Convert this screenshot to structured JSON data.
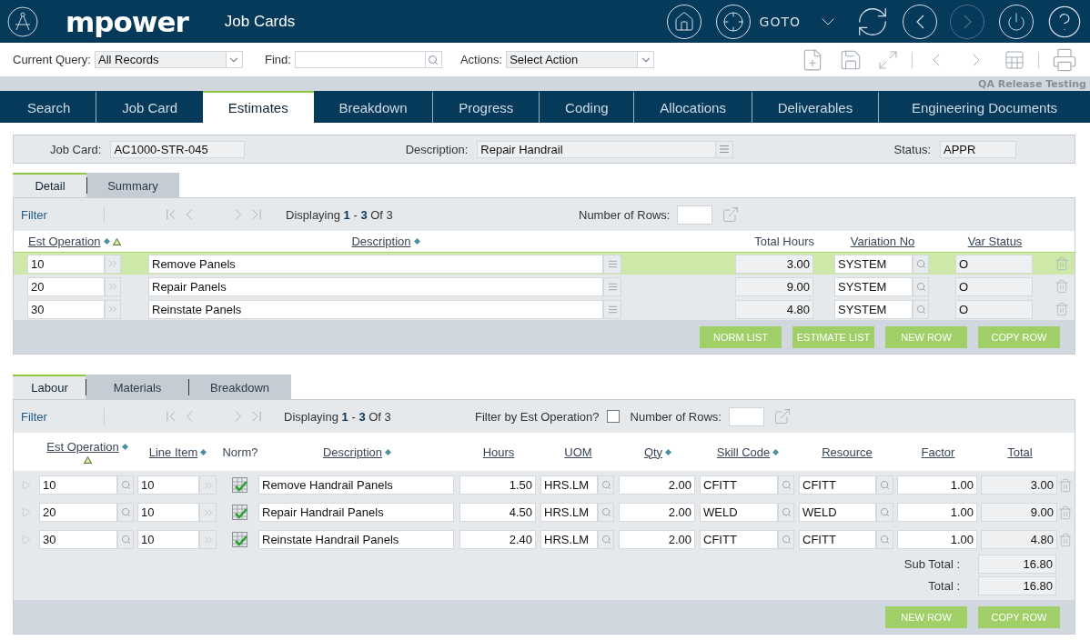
{
  "app": {
    "logo": "mpower",
    "title": "Job Cards",
    "goto_label": "GOTO",
    "nav": [
      {
        "kind": "back",
        "disabled": false
      },
      {
        "kind": "forward",
        "disabled": true
      }
    ]
  },
  "toolbar": {
    "query_label": "Current Query:",
    "query_value": "All Records",
    "find_label": "Find:",
    "actions_label": "Actions:",
    "actions_value": "Select Action"
  },
  "environment": "QA Release Testing",
  "tabs": [
    {
      "label": "Search",
      "selected": false
    },
    {
      "label": "Job Card",
      "selected": false
    },
    {
      "label": "Estimates",
      "selected": true
    },
    {
      "label": "Breakdown",
      "selected": false
    },
    {
      "label": "Progress",
      "selected": false
    },
    {
      "label": "Coding",
      "selected": false
    },
    {
      "label": "Allocations",
      "selected": false
    },
    {
      "label": "Deliverables",
      "selected": false
    },
    {
      "label": "Engineering Documents",
      "selected": false
    }
  ],
  "job": {
    "fields": [
      {
        "label": "Job Card:",
        "value": "AC1000-STR-045",
        "kind": "text"
      },
      {
        "label": "Description:",
        "value": "Repair Handrail",
        "kind": "memo"
      },
      {
        "label": "Status:",
        "value": "APPR",
        "kind": "text"
      }
    ]
  },
  "estimates": {
    "tabs": [
      {
        "label": "Detail",
        "selected": true
      },
      {
        "label": "Summary",
        "selected": false
      }
    ],
    "filter": "Filter",
    "displaying": "Displaying **1** - **3** Of 3",
    "rows_label": "Number of Rows:",
    "columns": [
      {
        "label": "Est Operation",
        "link": true,
        "sort": true,
        "sorted": true
      },
      {
        "label": "Description",
        "link": true,
        "sort": true,
        "sorted": false
      },
      {
        "label": "Total Hours",
        "link": false,
        "sort": false,
        "sorted": false
      },
      {
        "label": "Variation No",
        "link": true,
        "sort": false,
        "sorted": false
      },
      {
        "label": "Var Status",
        "link": true,
        "sort": false,
        "sorted": false
      }
    ],
    "rows": [
      {
        "operation": "10",
        "description": "Remove Panels",
        "total_hours": "3.00",
        "variation": "SYSTEM",
        "var_status": "O",
        "selected": true
      },
      {
        "operation": "20",
        "description": "Repair Panels",
        "total_hours": "9.00",
        "variation": "SYSTEM",
        "var_status": "O",
        "selected": false
      },
      {
        "operation": "30",
        "description": "Reinstate Panels",
        "total_hours": "4.80",
        "variation": "SYSTEM",
        "var_status": "O",
        "selected": false
      }
    ],
    "buttons": [
      "NORM LIST",
      "ESTIMATE LIST",
      "NEW ROW",
      "COPY ROW"
    ]
  },
  "labour": {
    "tabs": [
      {
        "label": "Labour",
        "selected": true
      },
      {
        "label": "Materials",
        "selected": false
      },
      {
        "label": "Breakdown",
        "selected": false
      }
    ],
    "filter": "Filter",
    "displaying": "Displaying **1** - **3** Of 3",
    "filter_by": {
      "label": "Filter by Est Operation?",
      "checked": false
    },
    "rows_label": "Number of Rows:",
    "columns": [
      {
        "label": "Est Operation",
        "link": true,
        "sort": true,
        "sorted": true
      },
      {
        "label": "Line Item",
        "link": true,
        "sort": true,
        "sorted": false
      },
      {
        "label": "Norm?",
        "link": false,
        "sort": false,
        "sorted": false
      },
      {
        "label": "Description",
        "link": true,
        "sort": true,
        "sorted": false
      },
      {
        "label": "Hours",
        "link": true,
        "sort": false,
        "sorted": false
      },
      {
        "label": "UOM",
        "link": true,
        "sort": false,
        "sorted": false
      },
      {
        "label": "Qty",
        "link": true,
        "sort": true,
        "sorted": false
      },
      {
        "label": "Skill Code",
        "link": true,
        "sort": true,
        "sorted": false
      },
      {
        "label": "Resource",
        "link": true,
        "sort": false,
        "sorted": false
      },
      {
        "label": "Factor",
        "link": true,
        "sort": false,
        "sorted": false
      },
      {
        "label": "Total",
        "link": true,
        "sort": false,
        "sorted": false
      }
    ],
    "rows": [
      {
        "expanded": false,
        "operation": "10",
        "line_item": "10",
        "norm": true,
        "description": "Remove Handrail Panels",
        "hours": "1.50",
        "uom": "HRS.LM",
        "qty": "2.00",
        "skill_code": "CFITT",
        "resource": "CFITT",
        "factor": "1.00",
        "total": "3.00"
      },
      {
        "expanded": false,
        "operation": "20",
        "line_item": "10",
        "norm": true,
        "description": "Repair Handrail Panels",
        "hours": "4.50",
        "uom": "HRS.LM",
        "qty": "2.00",
        "skill_code": "WELD",
        "resource": "WELD",
        "factor": "1.00",
        "total": "9.00"
      },
      {
        "expanded": false,
        "operation": "30",
        "line_item": "10",
        "norm": true,
        "description": "Reinstate Handrail Panels",
        "hours": "2.40",
        "uom": "HRS.LM",
        "qty": "2.00",
        "skill_code": "CFITT",
        "resource": "CFITT",
        "factor": "1.00",
        "total": "4.80"
      }
    ],
    "totals": [
      {
        "label": "Sub Total :",
        "value": "16.80"
      },
      {
        "label": "Total :",
        "value": "16.80"
      }
    ],
    "buttons": [
      "NEW ROW",
      "COPY ROW"
    ]
  }
}
